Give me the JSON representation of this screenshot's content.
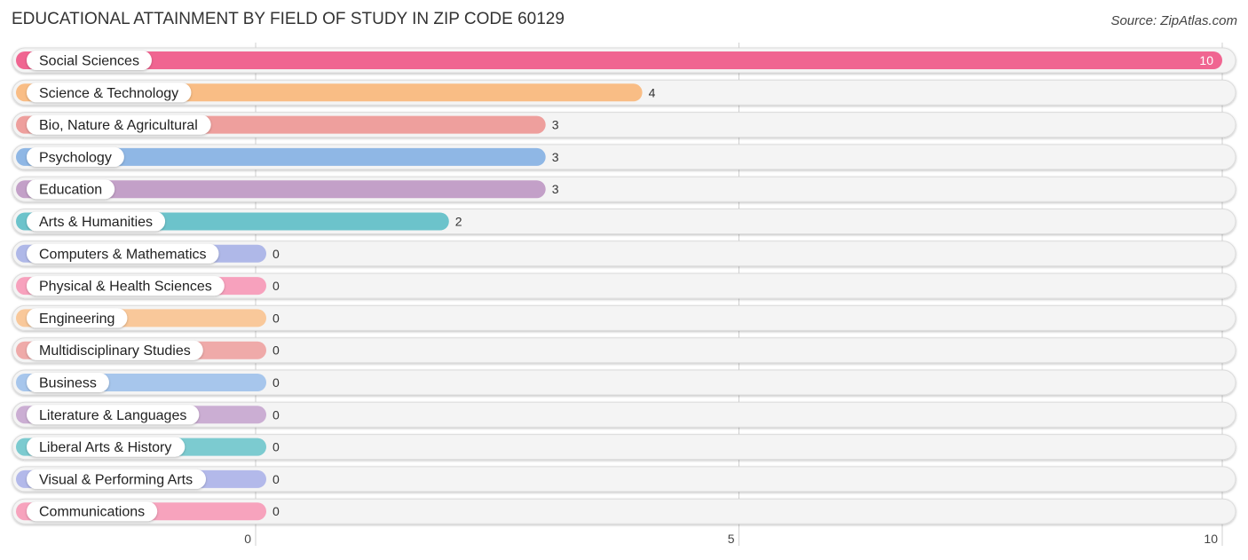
{
  "header": {
    "title": "EDUCATIONAL ATTAINMENT BY FIELD OF STUDY IN ZIP CODE 60129",
    "source": "Source: ZipAtlas.com"
  },
  "chart_data": {
    "type": "bar",
    "orientation": "horizontal",
    "title": "EDUCATIONAL ATTAINMENT BY FIELD OF STUDY IN ZIP CODE 60129",
    "xlabel": "",
    "ylabel": "",
    "xlim": [
      0,
      10
    ],
    "xticks": [
      0,
      5,
      10
    ],
    "grid": true,
    "categories": [
      "Social Sciences",
      "Science & Technology",
      "Bio, Nature & Agricultural",
      "Psychology",
      "Education",
      "Arts & Humanities",
      "Computers & Mathematics",
      "Physical & Health Sciences",
      "Engineering",
      "Multidisciplinary Studies",
      "Business",
      "Literature & Languages",
      "Liberal Arts & History",
      "Visual & Performing Arts",
      "Communications"
    ],
    "values": [
      10,
      4,
      3,
      3,
      3,
      2,
      0,
      0,
      0,
      0,
      0,
      0,
      0,
      0,
      0
    ],
    "value_labels": [
      "10",
      "4",
      "3",
      "3",
      "3",
      "2",
      "0",
      "0",
      "0",
      "0",
      "0",
      "0",
      "0",
      "0",
      "0"
    ],
    "colors": [
      "#f06591",
      "#f9bd85",
      "#ee9f9d",
      "#8fb7e5",
      "#c3a0c8",
      "#6cc3cb",
      "#afb8e8",
      "#f7a1bd",
      "#f9c89a",
      "#efaaa9",
      "#a7c6ec",
      "#cbaed3",
      "#7ccbd0",
      "#b3b9ea",
      "#f7a3bd"
    ]
  }
}
